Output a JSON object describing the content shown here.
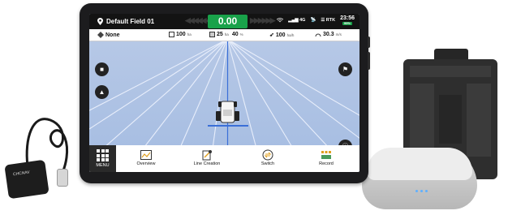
{
  "status_bar": {
    "field_name": "Default Field 01",
    "speed": "0.00",
    "signal": "4G",
    "rtk": "RTK",
    "time": "23:56",
    "battery": "99%"
  },
  "info_bar": {
    "implement": "None",
    "width_value": "100",
    "width_unit": "ha",
    "area_value": "25",
    "area_unit": "ha",
    "percent_value": "40",
    "percent_unit": "%",
    "rate_value": "100",
    "rate_unit": "ha/h",
    "distance_value": "30.3",
    "distance_unit": "m/s"
  },
  "menu": {
    "label": "MENU"
  },
  "tools": [
    {
      "label": "Overview",
      "icon": "overview-icon"
    },
    {
      "label": "Line Creation",
      "icon": "line-creation-icon"
    },
    {
      "label": "Switch",
      "icon": "switch-icon"
    },
    {
      "label": "Record",
      "icon": "record-icon"
    }
  ],
  "device": {
    "sensor_brand": "CHCNAV"
  },
  "colors": {
    "speed_green": "#19a24a",
    "map_blue": "#a9bfe0",
    "guide_line_blue": "#3a6fd8",
    "bar_black": "#131313"
  }
}
